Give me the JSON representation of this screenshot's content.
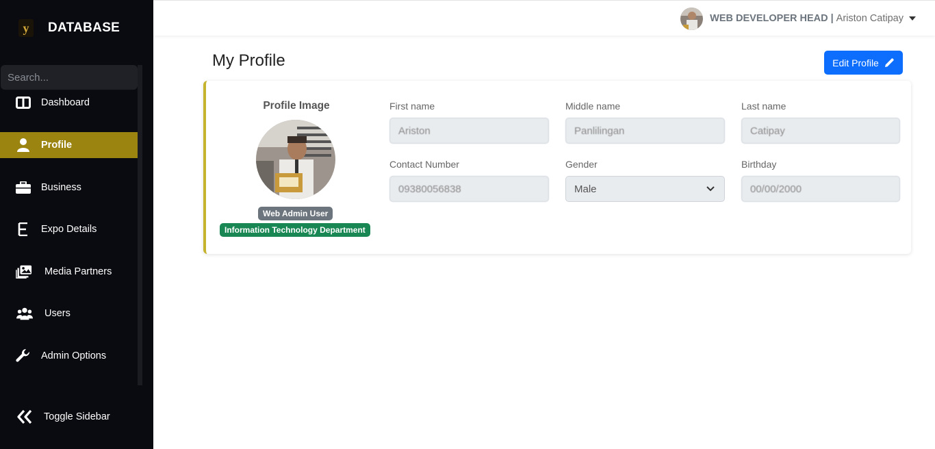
{
  "brand": {
    "name": "DATABASE"
  },
  "sidebar": {
    "search_placeholder": "Search...",
    "items": [
      {
        "label": "Dashboard",
        "icon": "columns-icon"
      },
      {
        "label": "Profile",
        "icon": "user-icon",
        "active": true
      },
      {
        "label": "Business",
        "icon": "briefcase-icon"
      },
      {
        "label": "Expo Details",
        "icon": "letter-e-icon"
      },
      {
        "label": "Media Partners",
        "icon": "photos-icon"
      },
      {
        "label": "Users",
        "icon": "users-icon"
      },
      {
        "label": "Admin Options",
        "icon": "wrench-icon"
      }
    ],
    "toggle_label": "Toggle Sidebar",
    "active_color": "#9b8410"
  },
  "topbar": {
    "role": "WEB DEVELOPER HEAD |",
    "user_name": "Ariston Catipay"
  },
  "main": {
    "title": "My Profile",
    "edit_button": "Edit Profile",
    "profile_image_title": "Profile Image",
    "role_badge": "Web Admin User",
    "department_badge": "Information Technology Department",
    "fields": {
      "first_name": {
        "label": "First name",
        "value": "Ariston"
      },
      "middle_name": {
        "label": "Middle name",
        "value": "Panlilingan"
      },
      "last_name": {
        "label": "Last name",
        "value": "Catipay"
      },
      "contact": {
        "label": "Contact Number",
        "value": "09380056838"
      },
      "gender": {
        "label": "Gender",
        "value": "Male"
      },
      "birthday": {
        "label": "Birthday",
        "value": "00/00/2000"
      }
    }
  },
  "colors": {
    "sidebar_bg": "#0a0b10",
    "accent": "#c5b32d",
    "primary": "#0d6efd",
    "success": "#198754",
    "secondary": "#6c757d"
  }
}
